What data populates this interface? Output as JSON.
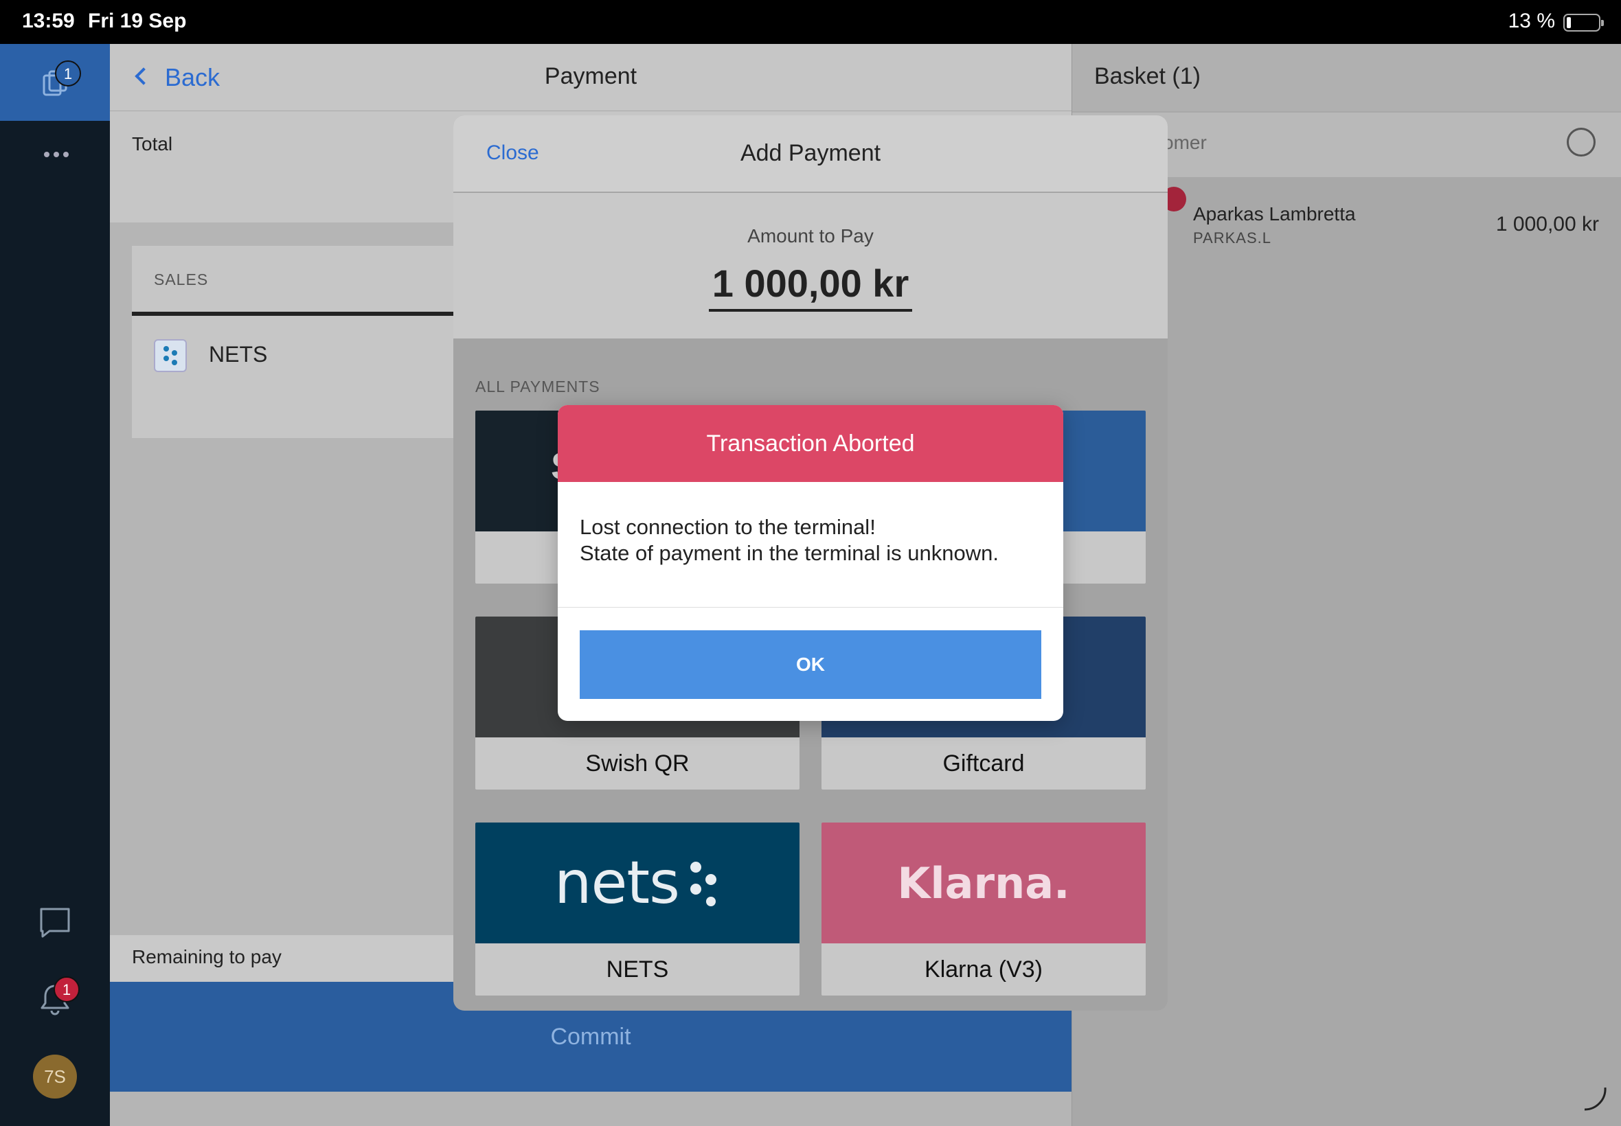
{
  "status_bar": {
    "time": "13:59",
    "date": "Fri 19 Sep",
    "battery": "13 %"
  },
  "rail": {
    "basket_badge": "1",
    "notifications_badge": "1",
    "avatar_initials": "7S"
  },
  "main": {
    "back_label": "Back",
    "title": "Payment",
    "total_label": "Total",
    "sales_label": "SALES",
    "payment_row": "NETS",
    "remaining_label": "Remaining to pay",
    "commit_label": "Commit"
  },
  "basket": {
    "title": "Basket (1)",
    "customer_placeholder": "omer",
    "item": {
      "name": "Aparkas Lambretta",
      "sku": "PARKAS.L",
      "price": "1 000,00 kr"
    }
  },
  "modal": {
    "close_label": "Close",
    "title": "Add Payment",
    "amount_label": "Amount to Pay",
    "amount_value": "1 000,00 kr",
    "all_payments_label": "ALL PAYMENTS",
    "tiles": {
      "swish_qr": "Swish QR",
      "giftcard": "Giftcard",
      "nets": "NETS",
      "klarna": "Klarna (V3)"
    },
    "logos": {
      "nets": "nets",
      "klarna": "Klarna.",
      "swish_partial": "S"
    }
  },
  "alert": {
    "title": "Transaction Aborted",
    "line1": "Lost connection to the terminal!",
    "line2": "State of payment in the terminal is unknown.",
    "ok_label": "OK"
  },
  "colors": {
    "accent_blue": "#2b6bd1",
    "alert_red": "#dc4766",
    "ok_blue": "#4a90e2",
    "nets_teal": "#00405f",
    "klarna_pink": "#c05a78"
  }
}
